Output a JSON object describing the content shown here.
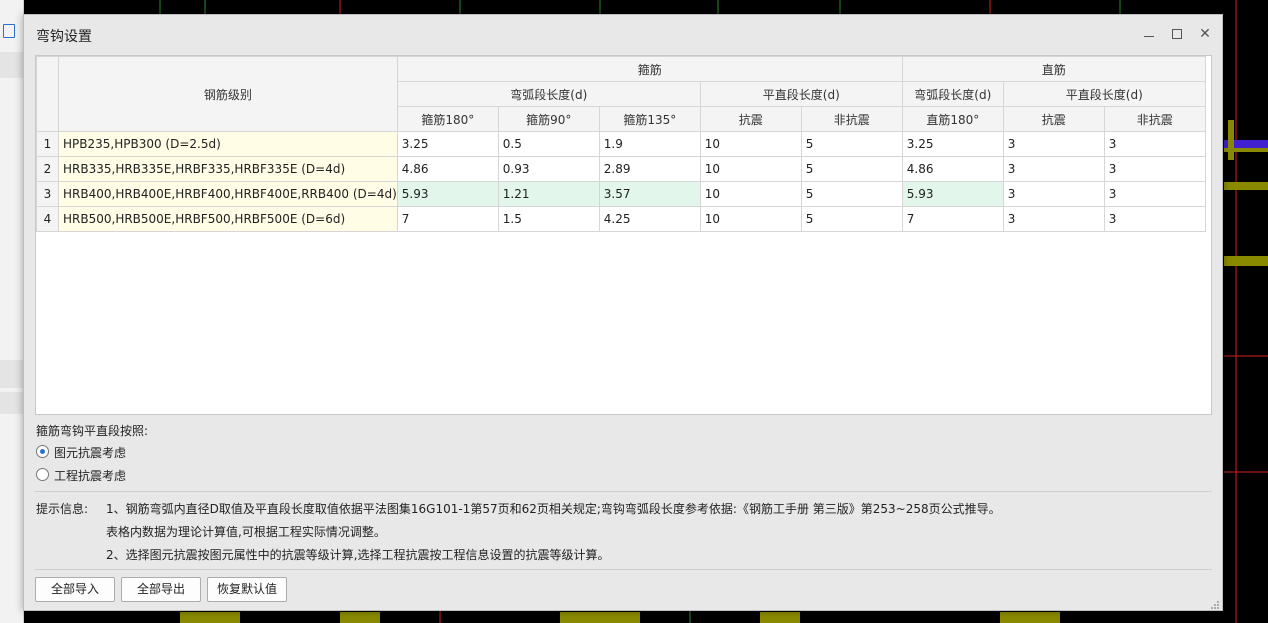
{
  "dialog": {
    "title": "弯钩设置"
  },
  "grid": {
    "header_grade": "钢筋级别",
    "header_stirrup": "箍筋",
    "header_straight": "直筋",
    "header_arc_len": "弯弧段长度(d)",
    "header_flat_len": "平直段长度(d)",
    "header_arc_len2": "弯弧段长度(d)",
    "header_flat_len2": "平直段长度(d)",
    "sub_headers": [
      "箍筋180°",
      "箍筋90°",
      "箍筋135°",
      "抗震",
      "非抗震",
      "直筋180°",
      "抗震",
      "非抗震"
    ],
    "rows": [
      {
        "num": "1",
        "grade": "HPB235,HPB300 (D=2.5d)",
        "v": [
          "3.25",
          "0.5",
          "1.9",
          "10",
          "5",
          "3.25",
          "3",
          "3"
        ]
      },
      {
        "num": "2",
        "grade": "HRB335,HRB335E,HRBF335,HRBF335E (D=4d)",
        "v": [
          "4.86",
          "0.93",
          "2.89",
          "10",
          "5",
          "4.86",
          "3",
          "3"
        ]
      },
      {
        "num": "3",
        "grade": "HRB400,HRB400E,HRBF400,HRBF400E,RRB400 (D=4d)",
        "v": [
          "5.93",
          "1.21",
          "3.57",
          "10",
          "5",
          "5.93",
          "3",
          "3"
        ]
      },
      {
        "num": "4",
        "grade": "HRB500,HRB500E,HRBF500,HRBF500E (D=6d)",
        "v": [
          "7",
          "1.5",
          "4.25",
          "10",
          "5",
          "7",
          "3",
          "3"
        ]
      }
    ]
  },
  "options": {
    "label": "箍筋弯钩平直段按照:",
    "radio1": "图元抗震考虑",
    "radio2": "工程抗震考虑",
    "selected": "radio1"
  },
  "tips": {
    "label": "提示信息:",
    "line1": "1、钢筋弯弧内直径D取值及平直段长度取值依据平法图集16G101-1第57页和62页相关规定;弯钩弯弧段长度参考依据:《钢筋工手册  第三版》第253~258页公式推导。",
    "line2": "表格内数据为理论计算值,可根据工程实际情况调整。",
    "line3": "2、选择图元抗震按图元属性中的抗震等级计算,选择工程抗震按工程信息设置的抗震等级计算。"
  },
  "buttons": {
    "import_all": "全部导入",
    "export_all": "全部导出",
    "restore_default": "恢复默认值"
  },
  "colors": {
    "accent": "#2d6fd1",
    "grade_cell": "#fffde6",
    "selected_cell": "#e2f6ec",
    "cad_red": "#d42020",
    "cad_yellow": "#8a8a00",
    "cad_blue": "#4020d0"
  }
}
